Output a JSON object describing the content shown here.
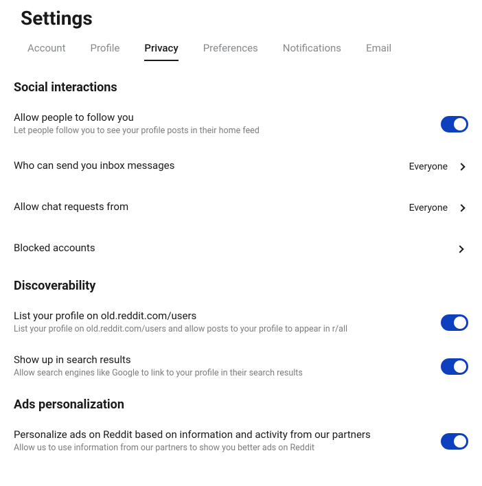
{
  "page": {
    "title": "Settings"
  },
  "tabs": {
    "account": "Account",
    "profile": "Profile",
    "privacy": "Privacy",
    "preferences": "Preferences",
    "notifications": "Notifications",
    "email": "Email"
  },
  "sections": {
    "social": {
      "heading": "Social interactions",
      "follow": {
        "title": "Allow people to follow you",
        "desc": "Let people follow you to see your profile posts in their home feed"
      },
      "inbox": {
        "title": "Who can send you inbox messages",
        "value": "Everyone"
      },
      "chat": {
        "title": "Allow chat requests from",
        "value": "Everyone"
      },
      "blocked": {
        "title": "Blocked accounts"
      }
    },
    "discoverability": {
      "heading": "Discoverability",
      "oldreddit": {
        "title": "List your profile on old.reddit.com/users",
        "desc": "List your profile on old.reddit.com/users and allow posts to your profile to appear in r/all"
      },
      "search": {
        "title": "Show up in search results",
        "desc": "Allow search engines like Google to link to your profile in their search results"
      }
    },
    "ads": {
      "heading": "Ads personalization",
      "personalize": {
        "title": "Personalize ads on Reddit based on information and activity from our partners",
        "desc": "Allow us to use information from our partners to show you better ads on Reddit"
      }
    }
  }
}
